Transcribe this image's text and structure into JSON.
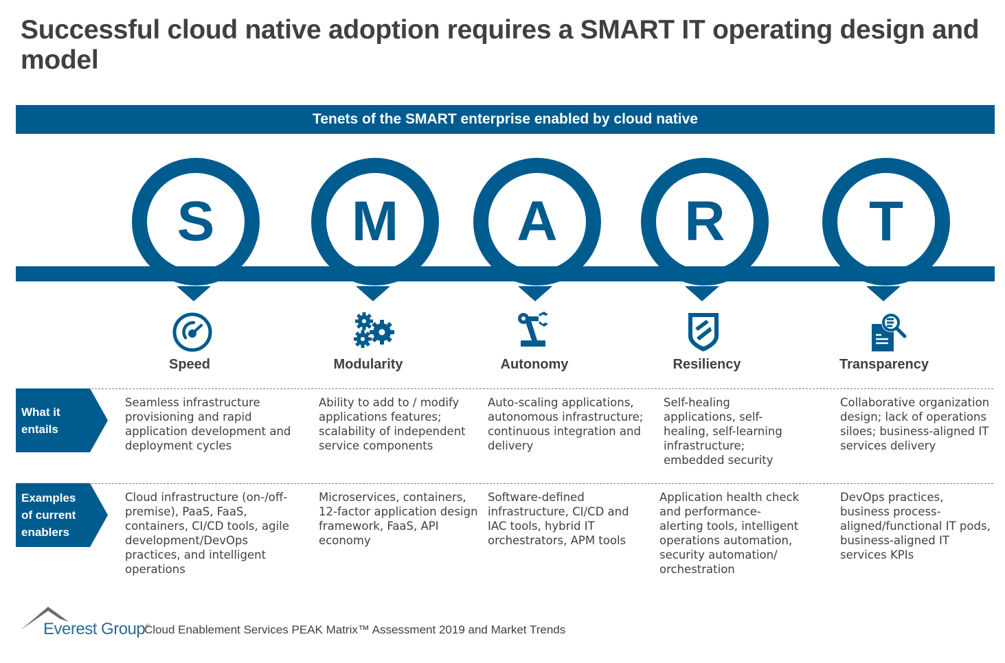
{
  "title": "Successful cloud native adoption requires a SMART IT operating design and model",
  "banner": "Tenets of the SMART enterprise enabled by cloud native",
  "accent_color": "#005B8E",
  "row_headers": {
    "what": [
      "What it",
      "entails"
    ],
    "examples": [
      "Examples",
      "of current",
      "enablers"
    ]
  },
  "tenets": [
    {
      "letter": "S",
      "name": "Speed",
      "icon": "speedometer-icon",
      "what_it_entails": "Seamless infrastructure provisioning and rapid application development and deployment cycles",
      "examples": "Cloud infrastructure (on-/off-premise), PaaS, FaaS, containers, CI/CD tools, agile development/DevOps practices, and intelligent operations"
    },
    {
      "letter": "M",
      "name": "Modularity",
      "icon": "gears-icon",
      "what_it_entails": "Ability to add to / modify applications features; scalability of independent service components",
      "examples": "Microservices, containers, 12-factor application design framework, FaaS, API economy"
    },
    {
      "letter": "A",
      "name": "Autonomy",
      "icon": "robotic-arm-icon",
      "what_it_entails": "Auto-scaling applications, autonomous infrastructure; continuous integration and delivery",
      "examples": "Software-defined infrastructure, CI/CD and IAC tools, hybrid IT orchestrators, APM tools"
    },
    {
      "letter": "R",
      "name": "Resiliency",
      "icon": "shield-icon",
      "what_it_entails": "Self-healing applications, self-healing, self-learning infrastructure; embedded security",
      "examples": "Application health check and performance-alerting tools, intelligent operations automation, security automation/ orchestration"
    },
    {
      "letter": "T",
      "name": "Transparency",
      "icon": "document-search-icon",
      "what_it_entails": "Collaborative organization design; lack of operations siloes; business-aligned IT services delivery",
      "examples": "DevOps practices, business process-aligned/functional IT pods, business-aligned IT services KPIs"
    }
  ],
  "footer": {
    "brand": "Everest Group",
    "registered": "®",
    "text": "Cloud Enablement Services PEAK Matrix™ Assessment 2019 and Market Trends"
  }
}
